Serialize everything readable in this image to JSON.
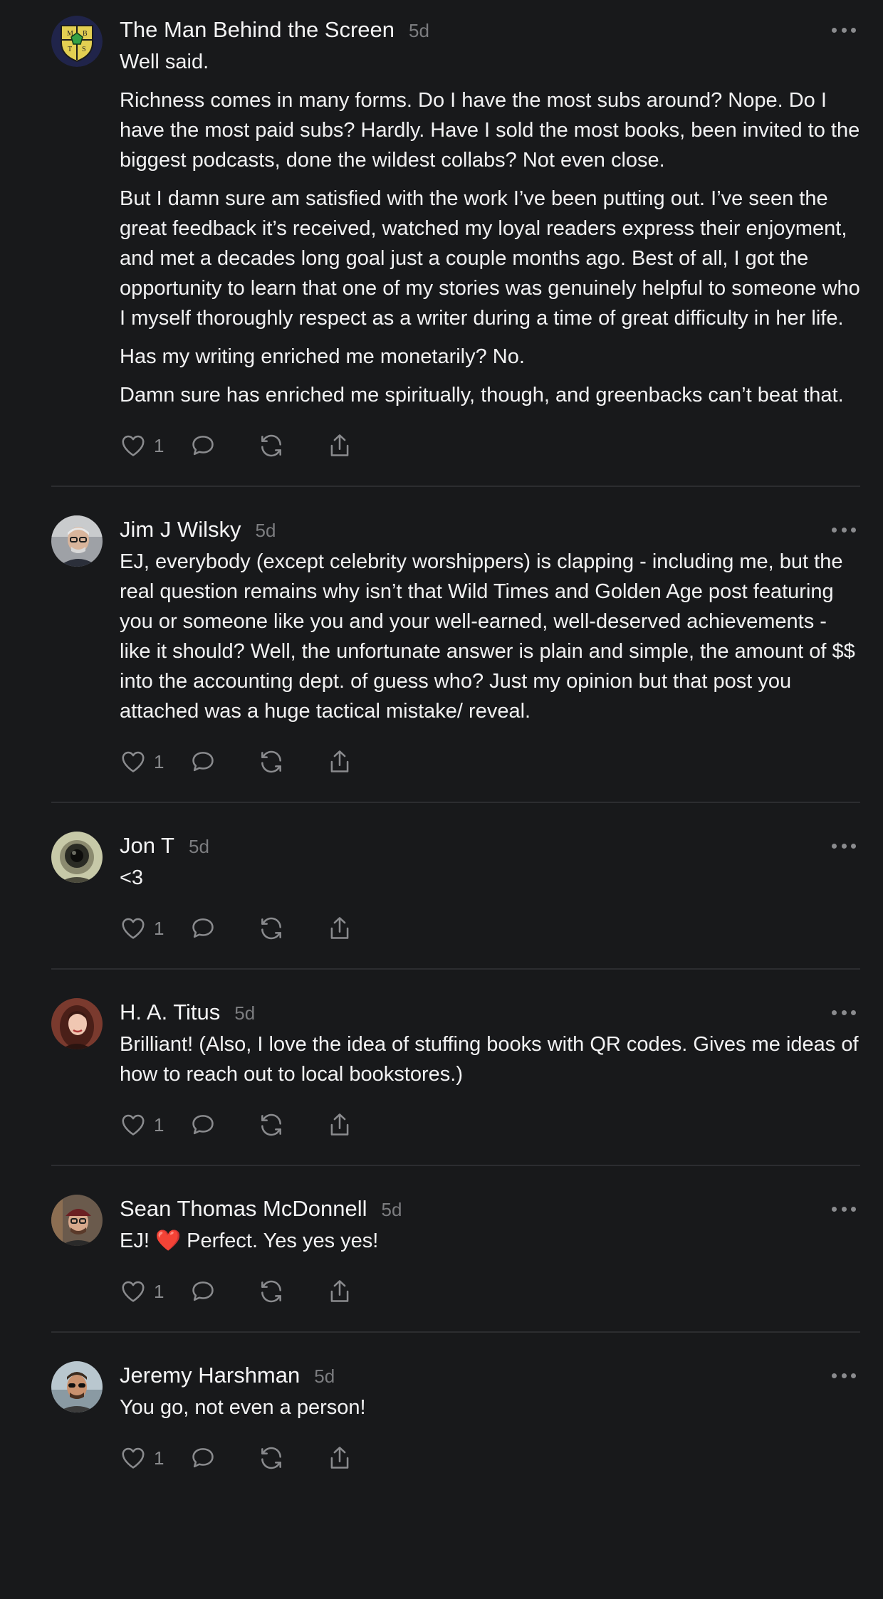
{
  "comments": [
    {
      "author": "The Man Behind the Screen",
      "time": "5d",
      "avatar_icon": "dnd-shield-crest",
      "paragraphs": [
        "Well said.",
        "Richness comes in many forms. Do I have the most subs around? Nope. Do I have the most paid subs? Hardly. Have I sold the most books, been invited to the biggest podcasts, done the wildest collabs? Not even close.",
        "But I damn sure am satisfied with the work I’ve been putting out. I’ve seen the great feedback it’s received, watched my loyal readers express their enjoyment, and met a decades long goal just a couple months ago. Best of all, I got the opportunity to learn that one of my stories was genuinely helpful to someone who I myself thoroughly respect as a writer during a time of great difficulty in her life.",
        "Has my writing enriched me monetarily? No.",
        "Damn sure has enriched me spiritually, though, and greenbacks can’t beat that."
      ],
      "likes": "1"
    },
    {
      "author": "Jim J Wilsky",
      "time": "5d",
      "avatar_icon": "man-with-glasses-photo",
      "paragraphs": [
        "EJ, everybody (except celebrity worshippers) is clapping - including me, but the real question remains why isn’t that Wild Times and Golden Age post featuring you or someone like you and your well-earned, well-deserved achievements - like it should? Well, the unfortunate answer is plain and simple, the amount of $$ into the accounting dept. of guess who? Just my opinion but that post you attached was a huge tactical mistake/ reveal."
      ],
      "likes": "1"
    },
    {
      "author": "Jon T",
      "time": "5d",
      "avatar_icon": "astronaut-helmet-photo",
      "paragraphs": [
        "<3"
      ],
      "likes": "1"
    },
    {
      "author": "H. A. Titus",
      "time": "5d",
      "avatar_icon": "woman-portrait-photo",
      "paragraphs": [
        "Brilliant! (Also, I love the idea of stuffing books with QR codes. Gives me ideas of how to reach out to local bookstores.)"
      ],
      "likes": "1"
    },
    {
      "author": "Sean Thomas McDonnell",
      "time": "5d",
      "avatar_icon": "man-with-cap-photo",
      "paragraphs": [
        "EJ! ❤️ Perfect. Yes yes yes!"
      ],
      "likes": "1"
    },
    {
      "author": "Jeremy Harshman",
      "time": "5d",
      "avatar_icon": "man-with-sunglasses-photo",
      "paragraphs": [
        "You go, not even a person!"
      ],
      "likes": "1"
    }
  ],
  "icons": {
    "like": "heart-icon",
    "reply": "comment-bubble-icon",
    "restack": "restack-icon",
    "share": "share-icon",
    "menu": "more-options-icon"
  },
  "colors": {
    "background": "#18191b",
    "text": "#f2f2f3",
    "muted": "#8a8b8e",
    "divider": "#2c2d30"
  }
}
